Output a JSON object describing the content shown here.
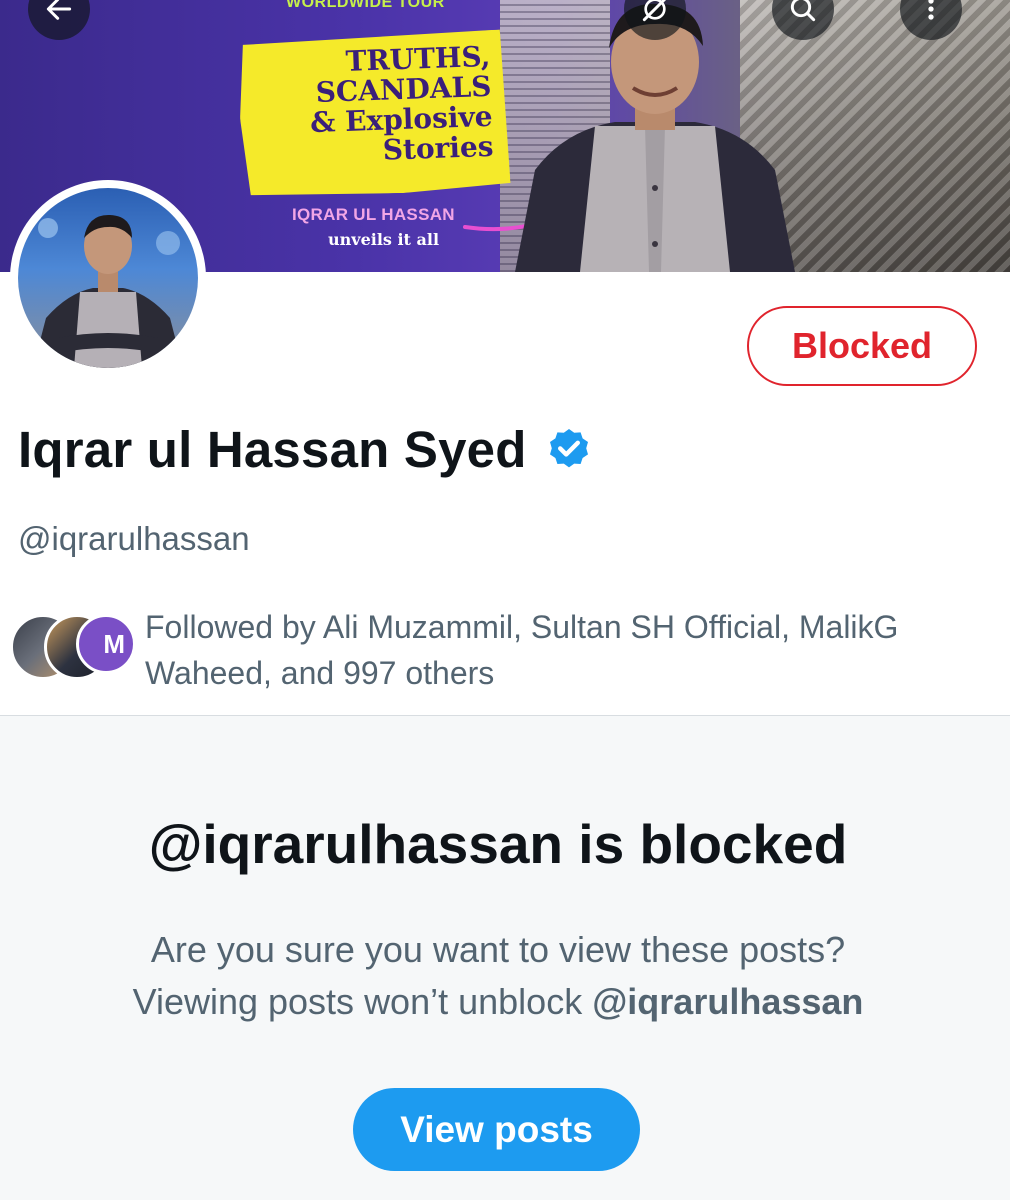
{
  "banner": {
    "tour_label": "WORLDWIDE TOUR",
    "headline_lines": [
      "TRUTHS,",
      "SCANDALS",
      "& Explosive",
      "Stories"
    ],
    "host_name": "IQRAR UL HASSAN",
    "host_sub": "unveils it all"
  },
  "top_bar": {
    "back_icon": "arrow-left-icon",
    "grok_icon": "grok-icon",
    "search_icon": "search-icon",
    "more_icon": "more-vertical-icon"
  },
  "profile": {
    "display_name": "Iqrar ul Hassan Syed",
    "handle": "@iqrarulhassan",
    "verified": true,
    "blocked_label": "Blocked",
    "followed_by_text": "Followed by Ali Muzammil, Sultan SH Official, MalikG Waheed, and 997 others",
    "follower_avatar_initial": "M"
  },
  "blocked_notice": {
    "title": "@iqrarulhassan is blocked",
    "line1": "Are you sure you want to view these posts?",
    "line2_prefix": "Viewing posts won’t unblock ",
    "line2_handle": "@iqrarulhassan",
    "button_label": "View posts"
  },
  "colors": {
    "blocked_red": "#e0242d",
    "accent_blue": "#1d9bf0",
    "secondary_text": "#536471"
  }
}
